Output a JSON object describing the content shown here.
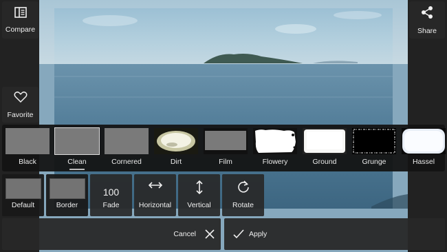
{
  "toolbar": {
    "compare_label": "Compare",
    "share_label": "Share",
    "favorite_label": "Favorite"
  },
  "borders": {
    "selected": "Clean",
    "items": [
      {
        "label": "Black",
        "style": "gray"
      },
      {
        "label": "Clean",
        "style": "gray"
      },
      {
        "label": "Cornered",
        "style": "gray"
      },
      {
        "label": "Dirt",
        "style": "dirt"
      },
      {
        "label": "Film",
        "style": "film"
      },
      {
        "label": "Flowery",
        "style": "flowery"
      },
      {
        "label": "Ground",
        "style": "ground"
      },
      {
        "label": "Grunge",
        "style": "grunge"
      },
      {
        "label": "Hassel",
        "style": "hassel"
      }
    ]
  },
  "options": {
    "default_label": "Default",
    "border_label": "Border",
    "fade_value": "100",
    "fade_label": "Fade",
    "horizontal_label": "Horizontal",
    "vertical_label": "Vertical",
    "rotate_label": "Rotate"
  },
  "actions": {
    "cancel_label": "Cancel",
    "apply_label": "Apply"
  },
  "colors": {
    "panel": "#282828",
    "sea": "#4f7a96",
    "sky": "#9fc3d6",
    "frame": "#c8d8e0"
  },
  "icons": {
    "compare": "compare-icon",
    "share": "share-icon",
    "favorite": "heart-icon",
    "horizontal": "horizontal-arrows-icon",
    "vertical": "vertical-arrows-icon",
    "rotate": "rotate-icon",
    "cancel": "close-icon",
    "apply": "check-icon"
  }
}
